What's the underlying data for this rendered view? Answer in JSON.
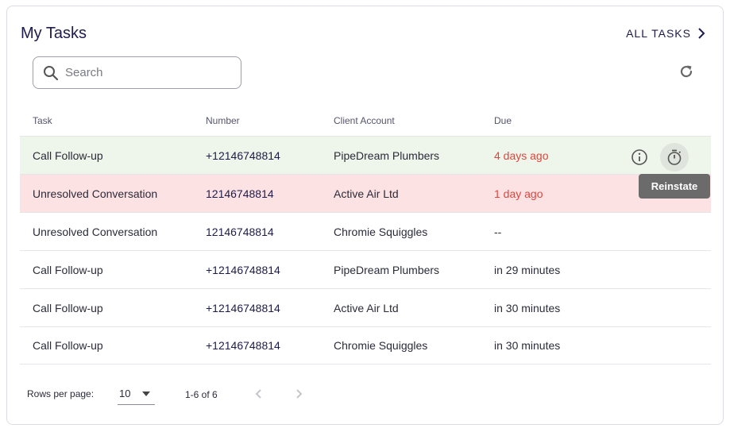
{
  "header": {
    "title": "My Tasks",
    "all_tasks_label": "ALL TASKS"
  },
  "search": {
    "placeholder": "Search",
    "value": ""
  },
  "table": {
    "columns": [
      "Task",
      "Number",
      "Client Account",
      "Due"
    ],
    "rows": [
      {
        "task": "Call Follow-up",
        "number": "+12146748814",
        "client": "PipeDream Plumbers",
        "due": "4 days ago",
        "highlight": "green",
        "due_overdue": true
      },
      {
        "task": "Unresolved Conversation",
        "number": "12146748814",
        "client": "Active Air Ltd",
        "due": "1 day ago",
        "highlight": "red",
        "due_overdue": true
      },
      {
        "task": "Unresolved Conversation",
        "number": "12146748814",
        "client": "Chromie Squiggles",
        "due": "--",
        "highlight": "none",
        "due_overdue": false
      },
      {
        "task": "Call Follow-up",
        "number": "+12146748814",
        "client": "PipeDream Plumbers",
        "due": "in 29 minutes",
        "highlight": "none",
        "due_overdue": false
      },
      {
        "task": "Call Follow-up",
        "number": "+12146748814",
        "client": "Active Air Ltd",
        "due": "in 30 minutes",
        "highlight": "none",
        "due_overdue": false
      },
      {
        "task": "Call Follow-up",
        "number": "+12146748814",
        "client": "Chromie Squiggles",
        "due": "in 30 minutes",
        "highlight": "none",
        "due_overdue": false
      }
    ]
  },
  "row_actions": {
    "info_icon": "info-icon",
    "timer_icon": "timer-icon",
    "tooltip": "Reinstate"
  },
  "footer": {
    "rows_per_page_label": "Rows per page:",
    "rows_per_page_value": "10",
    "range": "1-6 of 6"
  },
  "colors": {
    "accent": "#1d1b4b",
    "overdue": "#e0443b",
    "row_green": "#eef5ea",
    "row_red": "#fde2e4",
    "tooltip_bg": "#6b6b6b"
  }
}
